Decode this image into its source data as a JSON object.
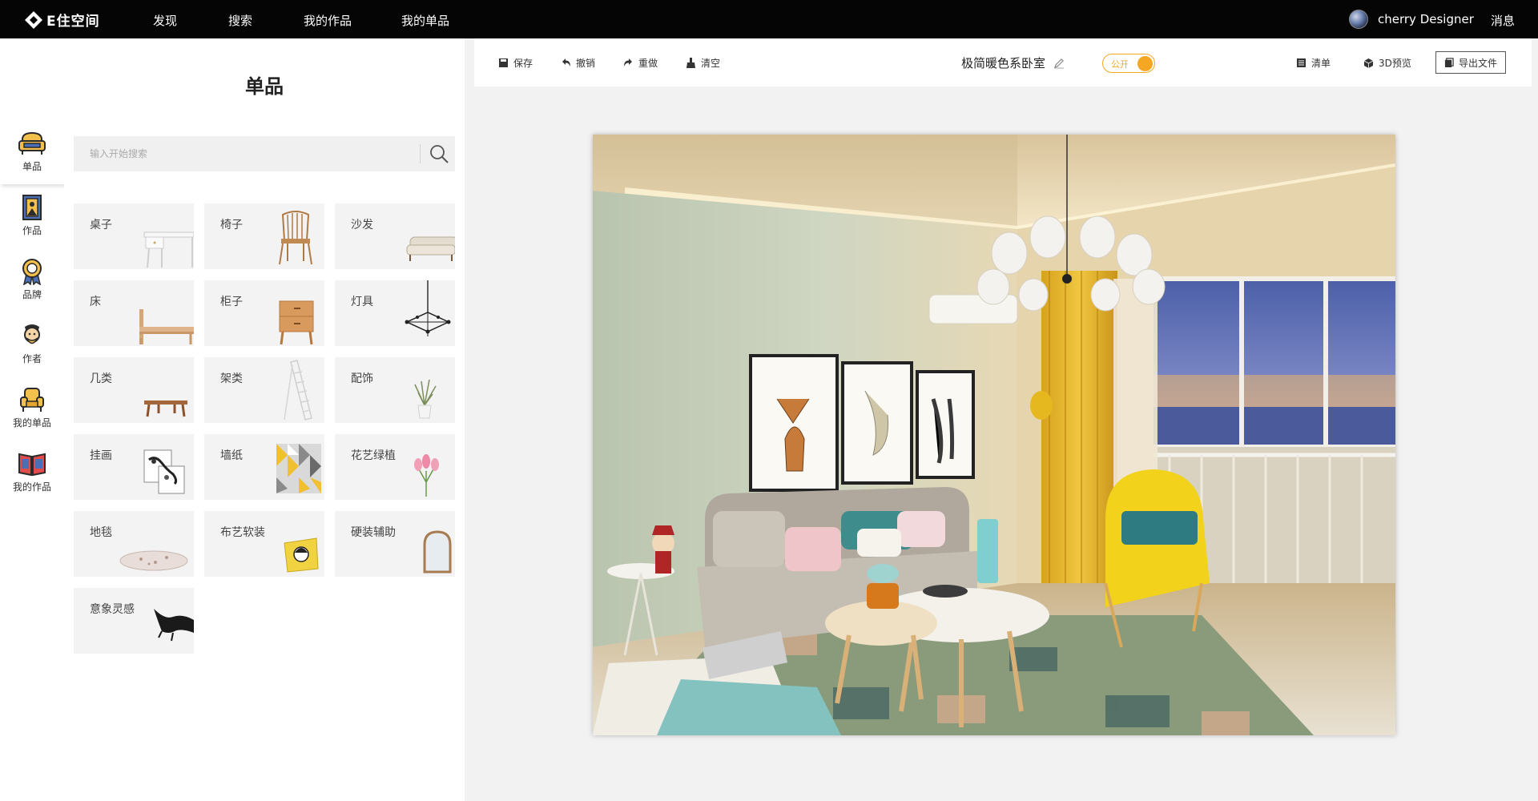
{
  "app": {
    "logo_text": "E住空间"
  },
  "nav": {
    "items": [
      "发现",
      "搜索",
      "我的作品",
      "我的单品"
    ]
  },
  "user": {
    "name": "cherry Designer",
    "messages_label": "消息"
  },
  "rail": {
    "items": [
      {
        "label": "单品",
        "icon": "sofa-icon"
      },
      {
        "label": "作品",
        "icon": "picture-frame-icon"
      },
      {
        "label": "品牌",
        "icon": "badge-icon"
      },
      {
        "label": "作者",
        "icon": "author-icon"
      },
      {
        "label": "我的单品",
        "icon": "armchair-icon"
      },
      {
        "label": "我的作品",
        "icon": "open-book-icon"
      }
    ]
  },
  "panel": {
    "title": "单品",
    "search_placeholder": "输入开始搜索",
    "categories": [
      "桌子",
      "椅子",
      "沙发",
      "床",
      "柜子",
      "灯具",
      "几类",
      "架类",
      "配饰",
      "挂画",
      "墙纸",
      "花艺绿植",
      "地毯",
      "布艺软装",
      "硬装辅助",
      "意象灵感"
    ]
  },
  "toolbar": {
    "save": "保存",
    "undo": "撤销",
    "redo": "重做",
    "clear": "清空",
    "doc_title": "极简暖色系卧室",
    "visibility_label": "公开",
    "list": "清单",
    "preview_3d": "3D预览",
    "export": "导出文件"
  },
  "colors": {
    "accent": "#f5a623",
    "topbar": "#050505",
    "panel_card": "#f3f3f3"
  }
}
